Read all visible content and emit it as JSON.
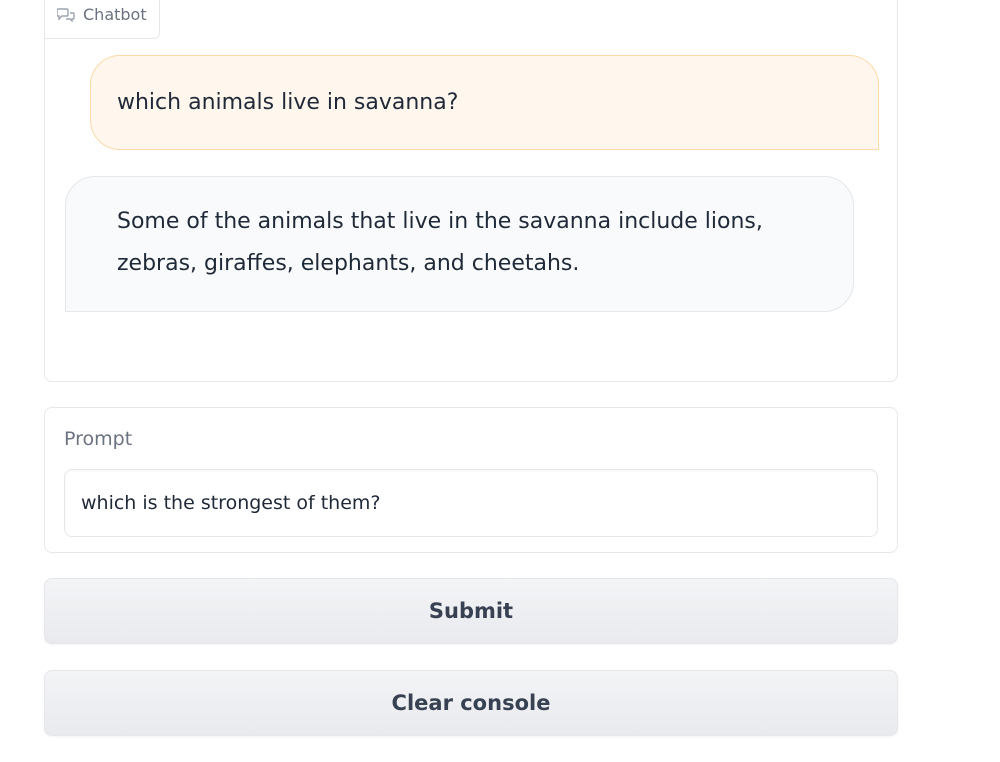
{
  "chatbot": {
    "label": "Chatbot",
    "label_icon": "chat-bubbles-icon",
    "messages": [
      {
        "role": "user",
        "text": "which animals live in savanna?"
      },
      {
        "role": "bot",
        "text": "Some of the animals that live in the savanna include lions, zebras, giraffes, elephants, and cheetahs."
      }
    ],
    "colors": {
      "user_bubble": "#fff7ed",
      "user_border": "#fcd9a8",
      "bot_bubble": "#f9fafb"
    }
  },
  "prompt": {
    "label": "Prompt",
    "value": "which is the strongest of them?"
  },
  "buttons": {
    "submit_label": "Submit",
    "clear_label": "Clear console"
  }
}
